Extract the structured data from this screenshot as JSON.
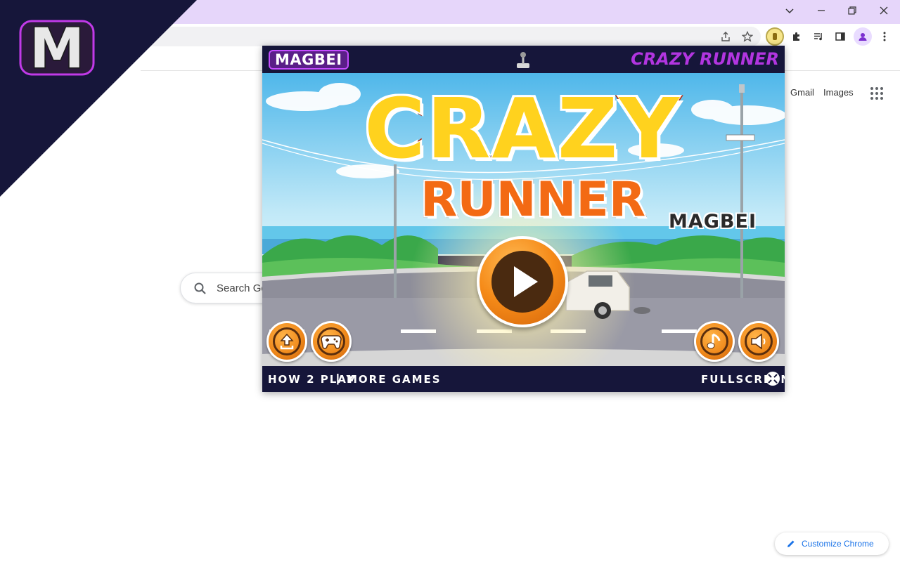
{
  "ntp": {
    "gmail_label": "Gmail",
    "images_label": "Images",
    "search_placeholder": "Search Go",
    "customize_label": "Customize Chrome"
  },
  "brand": {
    "corner_letter": "M"
  },
  "game": {
    "header_brand": "MAGBEI",
    "header_title": "CRAZY RUNNER",
    "title_line1": "CRAZY",
    "title_line2": "RUNNER",
    "scene_brand": "MAGBEI",
    "footer_how": "HOW 2 PLAY",
    "footer_sep": "|",
    "footer_more": "MORE GAMES",
    "footer_fullscreen": "FULLSCREEN"
  },
  "colors": {
    "titlebar": "#e6d6fa",
    "corner_bg": "#16163a",
    "game_accent": "#b235e0",
    "button_orange": "#f08a1c",
    "link_blue": "#1a73e8"
  },
  "icons": {
    "window_controls": [
      "chevron-down-icon",
      "minimize-icon",
      "restore-icon",
      "close-icon"
    ],
    "toolbar": [
      "share-icon",
      "star-icon",
      "extension-active-icon",
      "puzzle-icon",
      "media-icon",
      "side-panel-icon",
      "profile-icon",
      "menu-icon"
    ],
    "game_buttons": [
      "share-upload-icon",
      "gamepad-icon",
      "music-icon",
      "sound-icon",
      "play-icon",
      "fullscreen-icon",
      "joystick-icon"
    ]
  }
}
